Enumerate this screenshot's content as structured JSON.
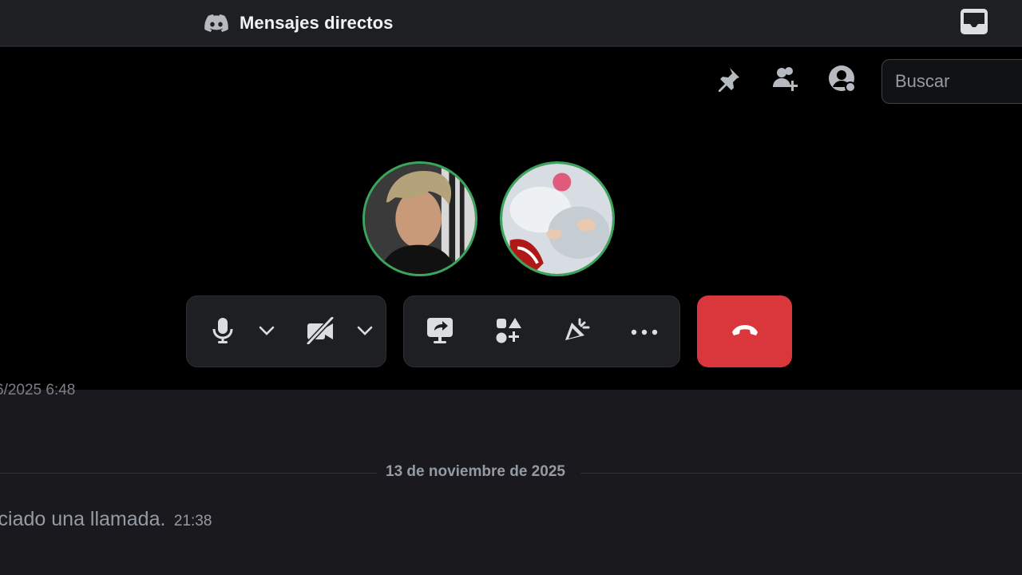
{
  "titlebar": {
    "title": "Mensajes directos",
    "brand_icon": "discord-logo-icon",
    "inbox_icon": "inbox-icon"
  },
  "header": {
    "icons": [
      "pin-icon",
      "add-friend-icon",
      "user-profile-icon"
    ],
    "search": {
      "placeholder": "Buscar",
      "value": ""
    }
  },
  "call": {
    "participants": [
      {
        "avatar": "avatar-user-1",
        "speaking_ring": "#3ba55c"
      },
      {
        "avatar": "avatar-user-2",
        "speaking_ring": "#3ba55c"
      }
    ],
    "controls": {
      "mic_icon": "microphone-icon",
      "mic_menu_icon": "chevron-down-icon",
      "camera_icon": "camera-off-icon",
      "camera_menu_icon": "chevron-down-icon",
      "share_screen_icon": "share-screen-icon",
      "activities_icon": "activities-icon",
      "soundboard_icon": "soundboard-icon",
      "more_icon": "more-icon",
      "end_call_icon": "hang-up-icon",
      "end_call_color": "#da373c"
    }
  },
  "chat": {
    "partial_timestamp": "6/2025 6:48",
    "date_divider": "13 de noviembre de 2025",
    "system_message": {
      "text": "iciado una llamada.",
      "time": "21:38"
    }
  },
  "colors": {
    "background": "#1a1a1e",
    "call_background": "#000000",
    "accent_green": "#3ba55c",
    "danger": "#da373c"
  }
}
